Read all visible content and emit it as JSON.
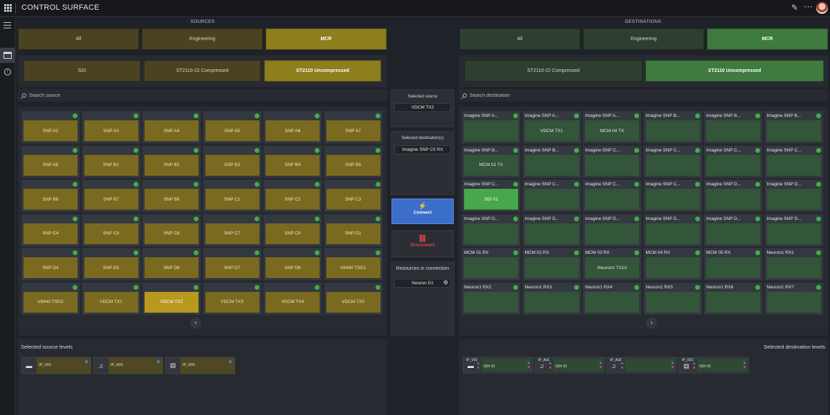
{
  "app": {
    "title": "CONTROL SURFACE",
    "icons": [
      "apps-grid-icon",
      "pencil-icon",
      "more-icon",
      "avatar"
    ]
  },
  "rail": {
    "icons": [
      "menu-icon",
      "control-surface-icon",
      "info-icon"
    ]
  },
  "sources": {
    "header": "SOURCES",
    "groups": [
      "All",
      "Engineering",
      "MCR"
    ],
    "active_group": "MCR",
    "types": [
      "SDI",
      "ST2110-22 Compressed",
      "ST2110 Uncompressed"
    ],
    "active_type": "ST2110 Uncompressed",
    "search_placeholder": "Search source",
    "tiles": [
      "SNP A2",
      "SNP A3",
      "SNP A4",
      "SNP A5",
      "SNP A6",
      "SNP A7",
      "SNP A8",
      "SNP B1",
      "SNP B2",
      "SNP B3",
      "SNP B4",
      "SNP B5",
      "SNP B6",
      "SNP B7",
      "SNP B8",
      "SNP C1",
      "SNP C2",
      "SNP C3",
      "SNP C4",
      "SNP C5",
      "SNP C6",
      "SNP C7",
      "SNP C8",
      "SNP D1",
      "SNP D4",
      "SNP D5",
      "SNP D6",
      "SNP D7",
      "SNP D8",
      "V8440 TSG1",
      "V8440 TSG2",
      "VDCM TX1",
      "VDCM TX2",
      "VDCM TX3",
      "VDCM TX4",
      "VDCM TX5"
    ],
    "selected_tile": "VDCM TX2",
    "pager": "‹",
    "levels_title": "Selected source levels",
    "levels": [
      {
        "icon": "video-icon",
        "glyph": "▬",
        "name": "IP_V01"
      },
      {
        "icon": "audio-icon",
        "glyph": "♫",
        "name": "IP_A01"
      },
      {
        "icon": "data-icon",
        "glyph": "▤",
        "name": "IP_D01"
      }
    ],
    "accent": "#8d7e1e"
  },
  "middle": {
    "selected_source_label": "Selected source",
    "selected_source": "VDCM TX2",
    "selected_dest_label": "Selected destination(s)",
    "selected_dest": "Imagine SNP C5 RX",
    "connect": "Connect",
    "disconnect": "Disconnect",
    "resources_label": "Resources in connection",
    "resource": "Neuron D1",
    "connect_color": "#3b6ec8",
    "disconnect_color": "#e04545"
  },
  "destinations": {
    "header": "DESTINATIONS",
    "groups": [
      "All",
      "Engineering",
      "MCR"
    ],
    "active_group": "MCR",
    "types": [
      "ST2110-22 Compressed",
      "ST2110 Uncompressed"
    ],
    "active_type": "ST2110 Uncompressed",
    "search_placeholder": "Search destination",
    "tiles": [
      {
        "name": "Imagine SNP A...",
        "conn": ""
      },
      {
        "name": "Imagine SNP A...",
        "conn": "VDCM TX1"
      },
      {
        "name": "Imagine SNP A...",
        "conn": "MCM 04 TX"
      },
      {
        "name": "Imagine SNP B...",
        "conn": ""
      },
      {
        "name": "Imagine SNP B...",
        "conn": ""
      },
      {
        "name": "Imagine SNP B...",
        "conn": ""
      },
      {
        "name": "Imagine SNP B...",
        "conn": "MCM 02 TX"
      },
      {
        "name": "Imagine SNP B...",
        "conn": ""
      },
      {
        "name": "Imagine SNP C...",
        "conn": ""
      },
      {
        "name": "Imagine SNP C...",
        "conn": ""
      },
      {
        "name": "Imagine SNP C...",
        "conn": ""
      },
      {
        "name": "Imagine SNP C...",
        "conn": ""
      },
      {
        "name": "Imagine SNP C...",
        "conn": "SDI 01",
        "selected": true
      },
      {
        "name": "Imagine SNP C...",
        "conn": ""
      },
      {
        "name": "Imagine SNP C...",
        "conn": ""
      },
      {
        "name": "Imagine SNP C...",
        "conn": ""
      },
      {
        "name": "Imagine SNP D...",
        "conn": ""
      },
      {
        "name": "Imagine SNP D...",
        "conn": ""
      },
      {
        "name": "Imagine SNP D...",
        "conn": ""
      },
      {
        "name": "Imagine SNP D...",
        "conn": ""
      },
      {
        "name": "Imagine SNP D...",
        "conn": ""
      },
      {
        "name": "Imagine SNP D...",
        "conn": ""
      },
      {
        "name": "Imagine SNP D...",
        "conn": ""
      },
      {
        "name": "Imagine SNP D...",
        "conn": ""
      },
      {
        "name": "MCM 01 RX",
        "conn": ""
      },
      {
        "name": "MCM 02 RX",
        "conn": ""
      },
      {
        "name": "MCM 03 RX",
        "conn": "Neuron1 TX10"
      },
      {
        "name": "MCM 04 RX",
        "conn": ""
      },
      {
        "name": "MCM 05 RX",
        "conn": ""
      },
      {
        "name": "Neuron1 RX1",
        "conn": ""
      },
      {
        "name": "Neuron1 RX2",
        "conn": ""
      },
      {
        "name": "Neuron1 RX3",
        "conn": ""
      },
      {
        "name": "Neuron1 RX4",
        "conn": ""
      },
      {
        "name": "Neuron1 RX5",
        "conn": ""
      },
      {
        "name": "Neuron1 RX6",
        "conn": ""
      },
      {
        "name": "Neuron1 RX7",
        "conn": ""
      }
    ],
    "pager": "›",
    "levels_title": "Selected destination levels",
    "levels": [
      {
        "icon": "video-icon",
        "glyph": "▬",
        "cap": "IP_V01",
        "name": "SDI 01"
      },
      {
        "icon": "audio-icon",
        "glyph": "♫",
        "cap": "IP_A01",
        "name": "SDI 01"
      },
      {
        "icon": "audio-icon",
        "glyph": "♫",
        "cap": "IP_A02",
        "name": ""
      },
      {
        "icon": "data-icon",
        "glyph": "▤",
        "cap": "IP_D01",
        "name": "SDI 01"
      }
    ],
    "accent": "#3f7a3f"
  }
}
